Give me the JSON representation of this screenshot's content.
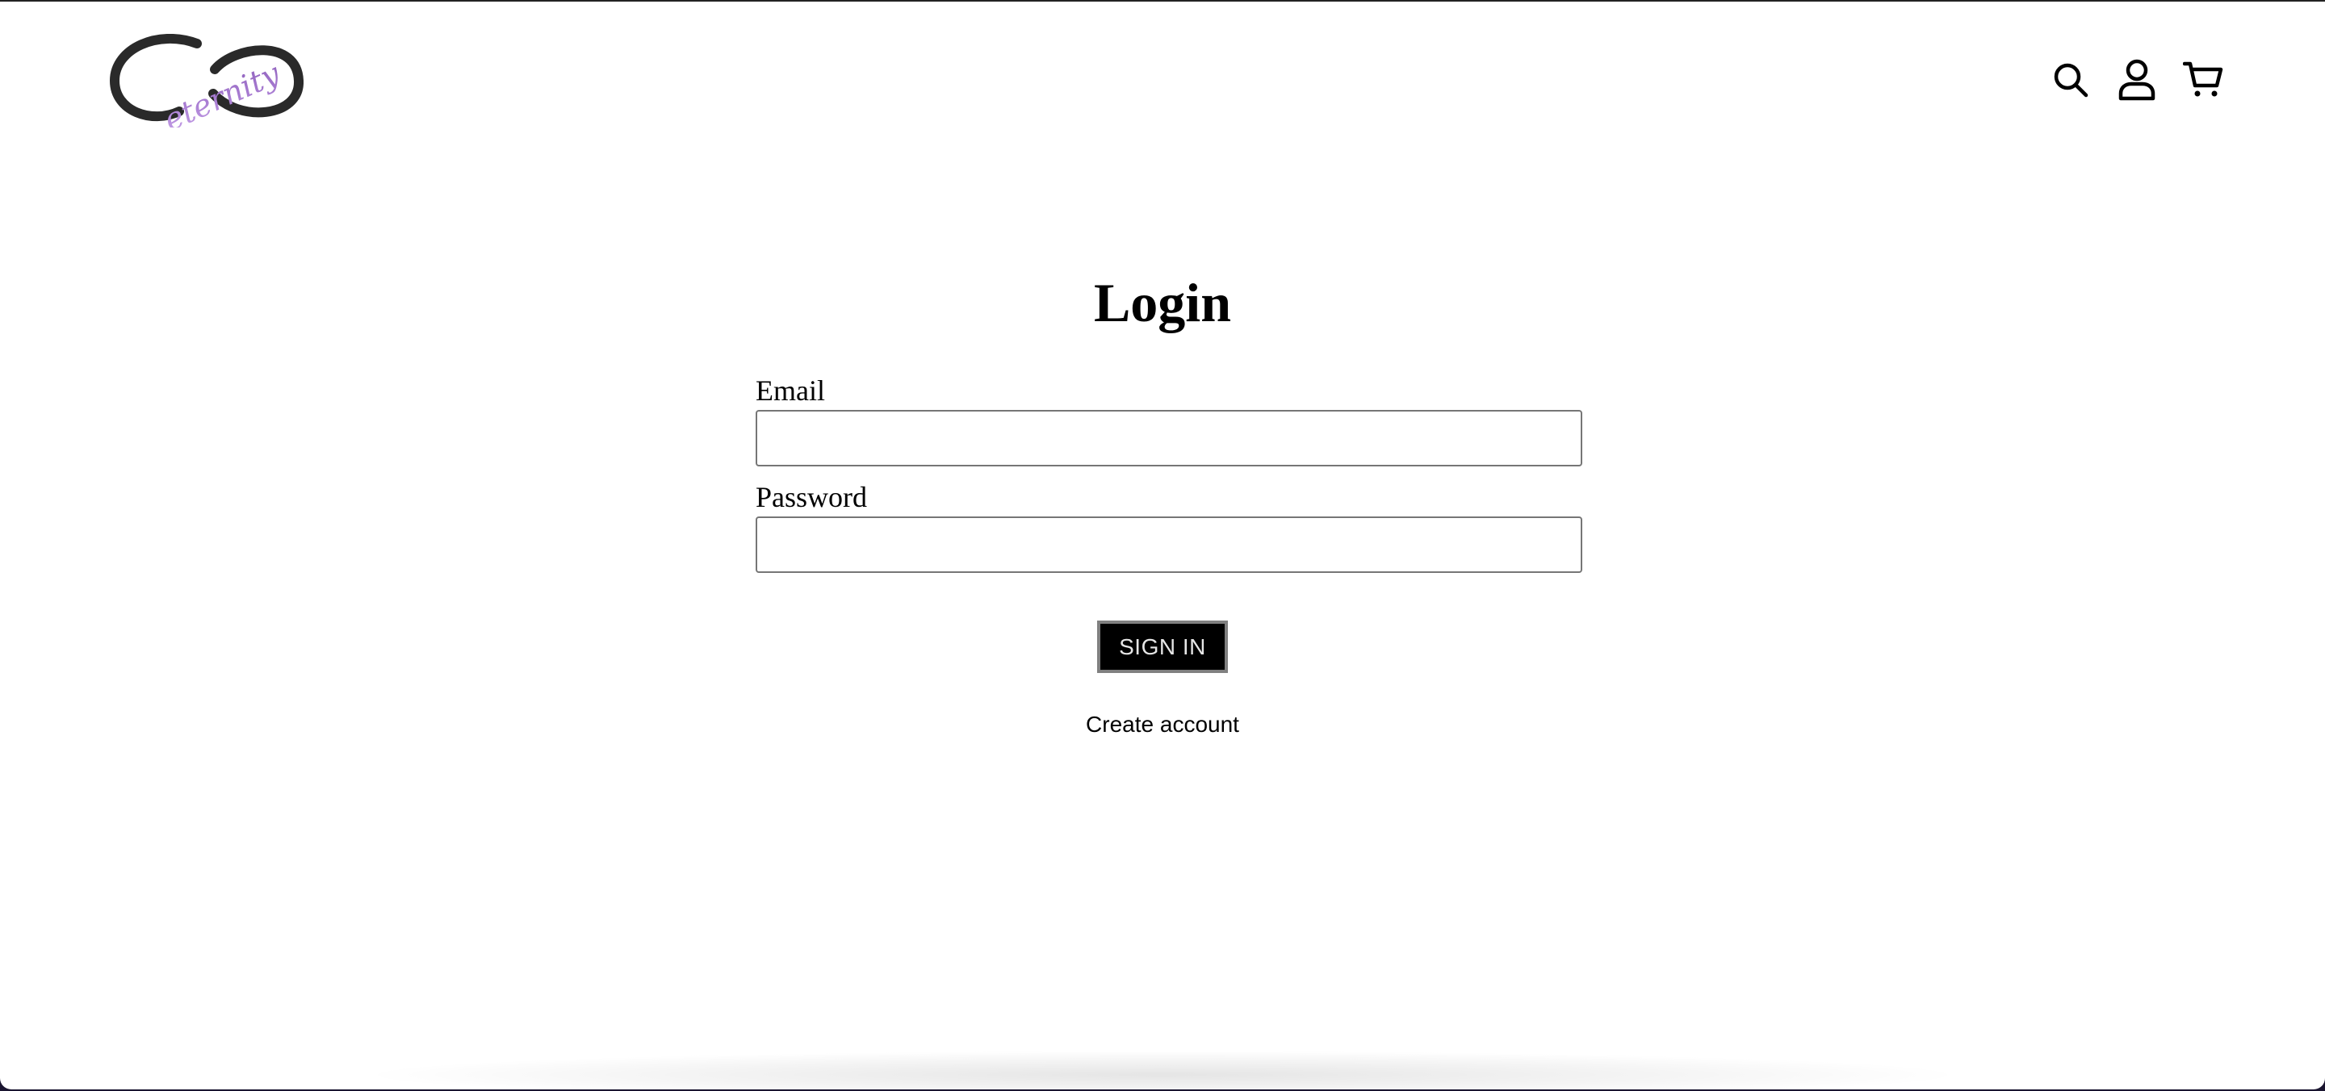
{
  "header": {
    "logo_text": "eternity",
    "icons": [
      "search-icon",
      "account-icon",
      "cart-icon"
    ]
  },
  "main": {
    "title": "Login",
    "email_label": "Email",
    "email_value": "",
    "password_label": "Password",
    "password_value": "",
    "signin_label": "SIGN IN",
    "create_account_label": "Create account"
  },
  "colors": {
    "logo_accent": "#a77bd1",
    "logo_dark": "#2a2a2a",
    "button_bg": "#000000",
    "button_border": "#808080",
    "button_text": "#e6e6e6"
  }
}
